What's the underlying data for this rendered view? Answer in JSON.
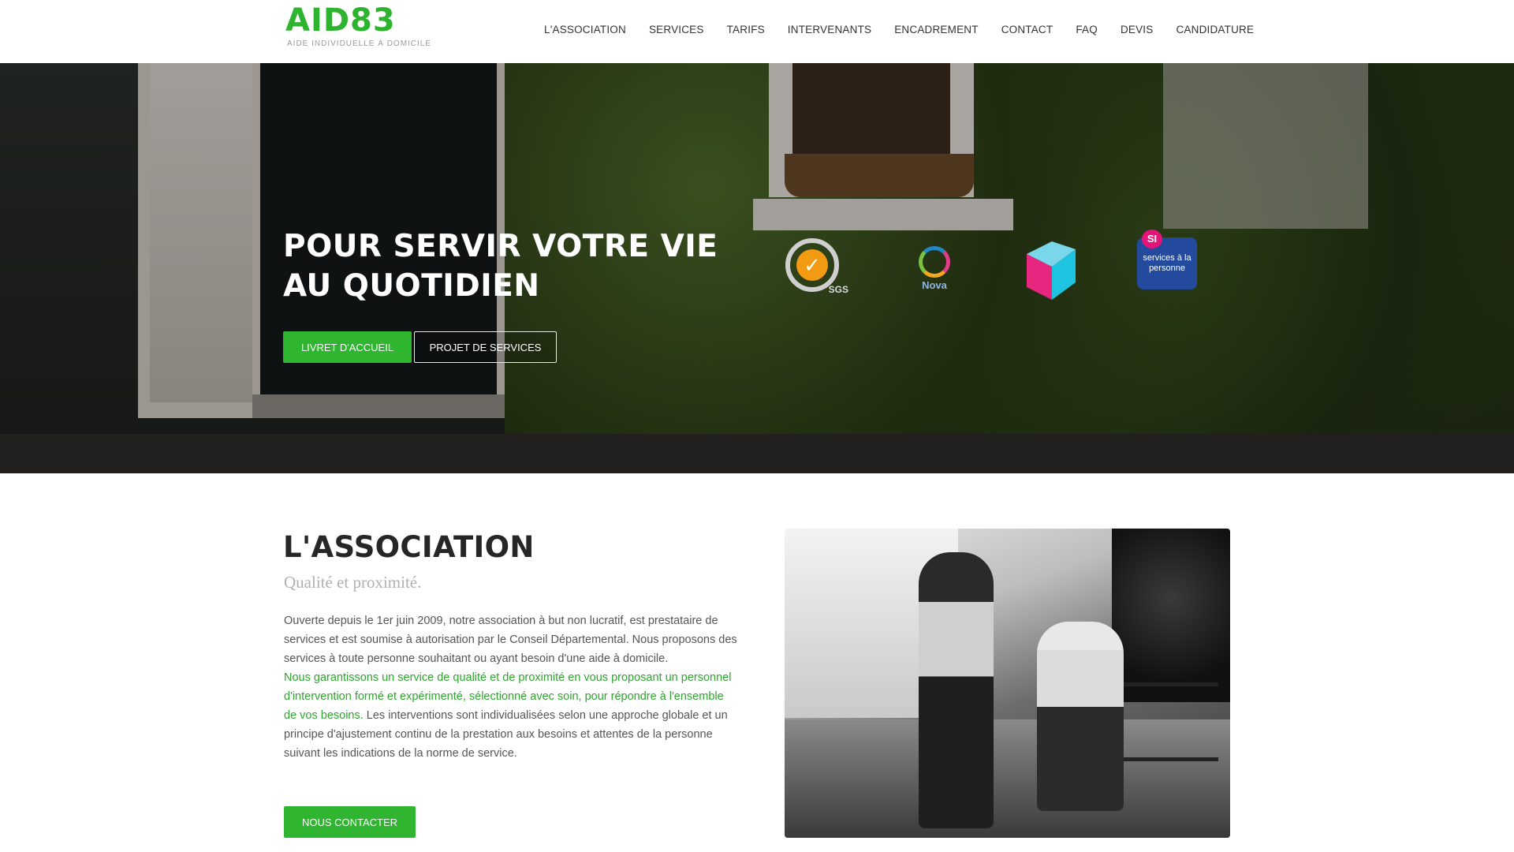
{
  "logo": {
    "main": "AID83",
    "sub": "AIDE INDIVIDUELLE À DOMICILE"
  },
  "nav": {
    "items": [
      "L'ASSOCIATION",
      "SERVICES",
      "TARIFS",
      "INTERVENANTS",
      "ENCADREMENT",
      "CONTACT",
      "FAQ",
      "DEVIS",
      "CANDIDATURE"
    ]
  },
  "hero": {
    "title_line1": "POUR SERVIR VOTRE VIE",
    "title_line2": "AU QUOTIDIEN",
    "btn_livret": "LIVRET D'ACCUEIL",
    "btn_projet": "PROJET DE SERVICES",
    "badges": {
      "sgs": "SGS",
      "nova": "Nova",
      "si": "SI",
      "si_text": "services à la personne"
    }
  },
  "association": {
    "title": "L'ASSOCIATION",
    "subtitle": "Qualité et proximité.",
    "para1": "Ouverte depuis le 1er juin 2009, notre association à but non lucratif, est prestataire de services et est soumise à autorisation par le Conseil Départemental. Nous proposons des services à toute personne souhaitant ou ayant besoin d'une aide à domicile.",
    "para2_green": "Nous garantissons un service de qualité et de proximité en vous proposant un personnel d'intervention formé et expérimenté, sélectionné avec soin, pour répondre à l'ensemble de vos besoins.",
    "para2_rest": " Les interventions sont individualisées selon une approche globale et un principe d'ajustement continu de la prestation aux besoins et attentes de la personne suivant les indications de la norme de service.",
    "btn_contact": "NOUS CONTACTER"
  },
  "colors": {
    "accent": "#2fb52f",
    "text": "#555555",
    "subtitle": "#b0b0b0"
  }
}
